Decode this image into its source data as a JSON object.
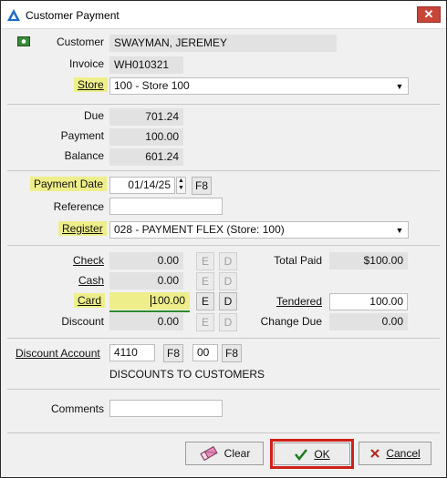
{
  "window": {
    "title": "Customer Payment",
    "close": "✕"
  },
  "customer": {
    "label": "Customer",
    "value": "SWAYMAN, JEREMEY"
  },
  "invoice": {
    "label": "Invoice",
    "value": "WH010321"
  },
  "store": {
    "label": "Store",
    "value": "100 - Store 100"
  },
  "amounts": {
    "due_label": "Due",
    "due": "701.24",
    "payment_label": "Payment",
    "payment": "100.00",
    "balance_label": "Balance",
    "balance": "601.24"
  },
  "payment_date": {
    "label": "Payment Date",
    "value": "01/14/25",
    "lookup": "F8"
  },
  "reference": {
    "label": "Reference",
    "value": ""
  },
  "register": {
    "label": "Register",
    "value": "028 - PAYMENT FLEX (Store: 100)"
  },
  "tenders": [
    {
      "label": "Check",
      "amount": "0.00",
      "e": "E",
      "d": "D"
    },
    {
      "label": "Cash",
      "amount": "0.00",
      "e": "E",
      "d": "D"
    },
    {
      "label": "Card",
      "amount": "100.00",
      "e": "E",
      "d": "D"
    },
    {
      "label": "Discount",
      "amount": "0.00",
      "e": "E",
      "d": "D"
    }
  ],
  "totals": {
    "total_paid_label": "Total Paid",
    "total_paid": "$100.00",
    "tendered_label": "Tendered",
    "tendered": "100.00",
    "change_due_label": "Change Due",
    "change_due": "0.00"
  },
  "discount_account": {
    "label": "Discount Account",
    "code": "4110",
    "lookup1": "F8",
    "sub": "00",
    "lookup2": "F8",
    "description": "DISCOUNTS TO CUSTOMERS"
  },
  "comments": {
    "label": "Comments",
    "value": ""
  },
  "buttons": {
    "clear": "Clear",
    "ok": "OK",
    "cancel": "Cancel"
  },
  "colors": {
    "highlight": "#eeee8a",
    "ok_frame": "#d0201a",
    "close": "#c8453b",
    "readonly": "#e2e2e2"
  }
}
